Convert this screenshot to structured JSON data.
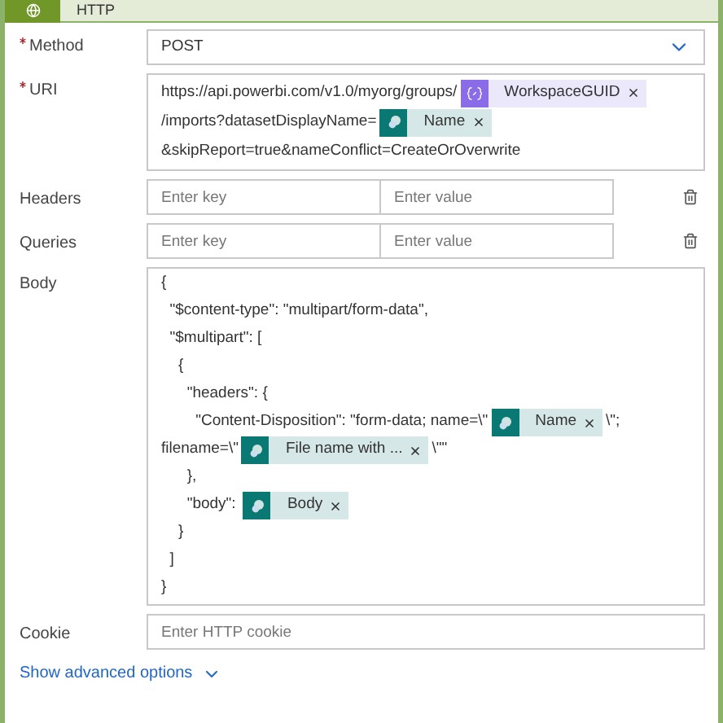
{
  "header": {
    "title": "HTTP"
  },
  "method": {
    "label": "Method",
    "required": true,
    "value": "POST"
  },
  "uri": {
    "label": "URI",
    "required": true,
    "lines": [
      [
        {
          "kind": "text",
          "text": "https://api.powerbi.com/v1.0/myorg/groups/"
        },
        {
          "kind": "variable",
          "label": "WorkspaceGUID"
        }
      ],
      [
        {
          "kind": "text",
          "text": "/imports?datasetDisplayName="
        },
        {
          "kind": "sharepoint",
          "label": "Name"
        }
      ],
      [
        {
          "kind": "text",
          "text": "&skipReport=true&nameConflict=CreateOrOverwrite"
        }
      ]
    ]
  },
  "pairs": [
    {
      "label": "Headers",
      "required": false,
      "key_placeholder": "Enter key",
      "value_placeholder": "Enter value"
    },
    {
      "label": "Queries",
      "required": false,
      "key_placeholder": "Enter key",
      "value_placeholder": "Enter value"
    }
  ],
  "body": {
    "label": "Body",
    "required": false,
    "lines": [
      [
        {
          "kind": "text",
          "text": "{"
        }
      ],
      [
        {
          "kind": "text",
          "text": "  \"$content-type\": \"multipart/form-data\","
        }
      ],
      [
        {
          "kind": "text",
          "text": "  \"$multipart\": ["
        }
      ],
      [
        {
          "kind": "text",
          "text": "    {"
        }
      ],
      [
        {
          "kind": "text",
          "text": "      \"headers\": {"
        }
      ],
      [
        {
          "kind": "text",
          "text": "        \"Content-Disposition\": \"form-data; name=\\\""
        },
        {
          "kind": "sharepoint",
          "label": "Name"
        },
        {
          "kind": "text",
          "text": "\\\";"
        }
      ],
      [
        {
          "kind": "text",
          "text": "filename=\\\""
        },
        {
          "kind": "sharepoint",
          "label": "File name with ..."
        },
        {
          "kind": "text",
          "text": "\\\"\""
        }
      ],
      [
        {
          "kind": "text",
          "text": "      },"
        }
      ],
      [
        {
          "kind": "text",
          "text": "      \"body\": "
        },
        {
          "kind": "sharepoint",
          "label": "Body"
        }
      ],
      [
        {
          "kind": "text",
          "text": "    }"
        }
      ],
      [
        {
          "kind": "text",
          "text": "  ]"
        }
      ],
      [
        {
          "kind": "text",
          "text": "}"
        }
      ]
    ]
  },
  "cookie": {
    "label": "Cookie",
    "required": false,
    "placeholder": "Enter HTTP cookie"
  },
  "advanced_link": "Show advanced options"
}
